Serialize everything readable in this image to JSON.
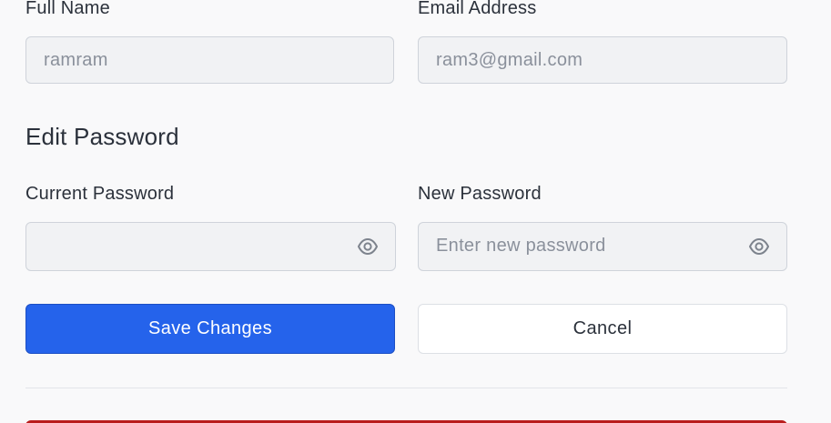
{
  "profile": {
    "full_name_label": "Full Name",
    "full_name_value": "ramram",
    "email_label": "Email Address",
    "email_value": "ram3@gmail.com"
  },
  "password_section": {
    "title": "Edit Password",
    "current_label": "Current Password",
    "current_value": "",
    "new_label": "New Password",
    "new_placeholder": "Enter new password"
  },
  "actions": {
    "save_label": "Save Changes",
    "cancel_label": "Cancel"
  },
  "icons": {
    "toggle_visibility": "eye-icon"
  },
  "colors": {
    "primary": "#2563eb",
    "danger": "#b91c1c"
  }
}
